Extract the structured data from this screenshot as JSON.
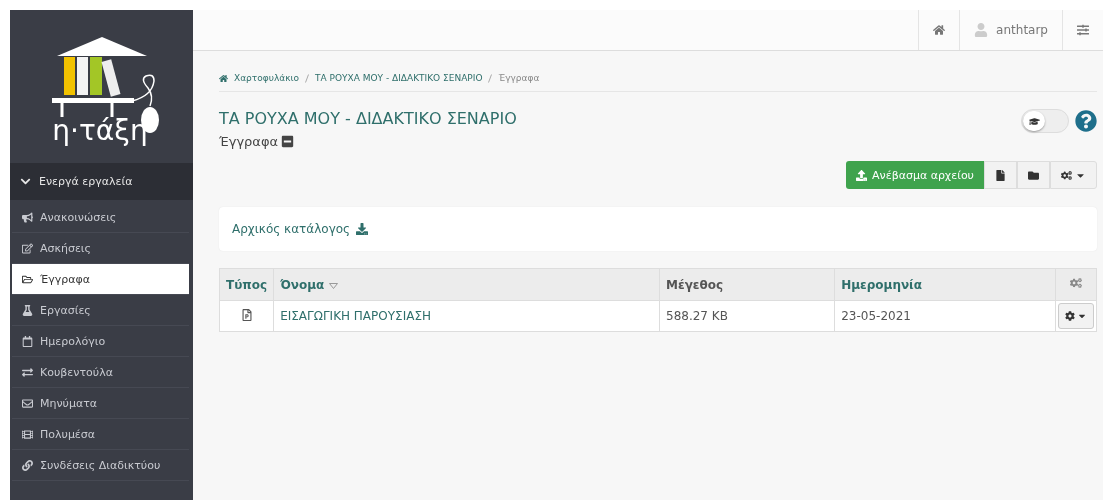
{
  "logo": {
    "text": "η·τάξη"
  },
  "sidebar": {
    "section": {
      "label": "Ενεργά εργαλεία",
      "expanded": true
    },
    "items": [
      {
        "label": "Ανακοινώσεις",
        "selected": false
      },
      {
        "label": "Ασκήσεις",
        "selected": false
      },
      {
        "label": "Έγγραφα",
        "selected": true
      },
      {
        "label": "Εργασίες",
        "selected": false
      },
      {
        "label": "Ημερολόγιο",
        "selected": false
      },
      {
        "label": "Κουβεντούλα",
        "selected": false
      },
      {
        "label": "Μηνύματα",
        "selected": false
      },
      {
        "label": "Πολυμέσα",
        "selected": false
      },
      {
        "label": "Συνδέσεις Διαδικτύου",
        "selected": false
      }
    ]
  },
  "topbar": {
    "user": "anthtarp"
  },
  "breadcrumb": [
    "Χαρτοφυλάκιο",
    "ΤΑ ΡΟΥΧΑ ΜΟΥ - ΔΙΔΑΚΤΙΚΟ ΣΕΝΑΡΙΟ",
    "Έγγραφα"
  ],
  "title": "ΤΑ ΡΟΥΧΑ ΜΟΥ - ΔΙΔΑΚΤΙΚΟ ΣΕΝΑΡΙΟ",
  "subtitle": "Έγγραφα",
  "toggle": {
    "on": false
  },
  "upload_button": "Ανέβασμα αρχείου",
  "folder_panel": {
    "label": "Αρχικός κατάλογος"
  },
  "table": {
    "columns": [
      "Τύπος",
      "Όνομα",
      "Μέγεθος",
      "Ημερομηνία"
    ],
    "rows": [
      {
        "name": "ΕΙΣΑΓΩΓΙΚΗ ΠΑΡΟΥΣΙΑΣΗ",
        "size": "588.27 KB",
        "date": "23-05-2021"
      }
    ]
  }
}
